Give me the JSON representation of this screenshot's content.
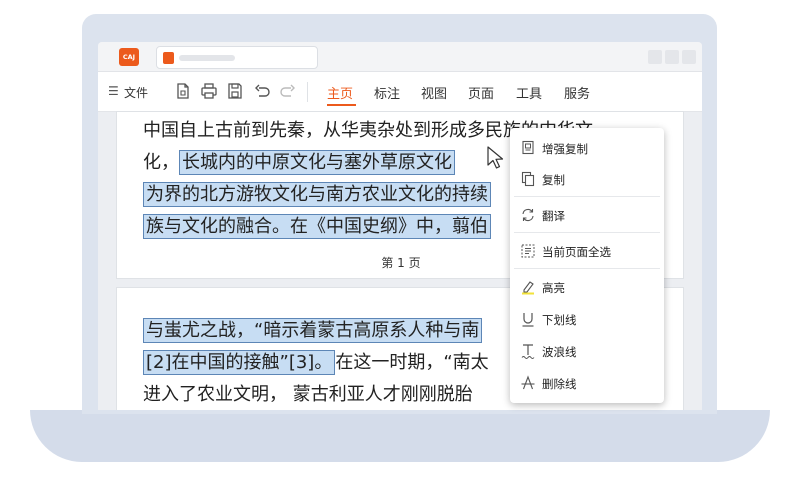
{
  "app": {
    "logo_text": "CAJ"
  },
  "toolbar": {
    "menu_glyph": "☰",
    "file_label": "文件",
    "tabs": [
      {
        "label": "主页",
        "active": true
      },
      {
        "label": "标注",
        "active": false
      },
      {
        "label": "视图",
        "active": false
      },
      {
        "label": "页面",
        "active": false
      },
      {
        "label": "工具",
        "active": false
      },
      {
        "label": "服务",
        "active": false
      }
    ]
  },
  "document": {
    "page1": {
      "line1": "中国自上古前到先秦，从华夷杂处到形成多民族的中华文",
      "line2_prefix": "化，",
      "line2_hl": "长城内的中原文化与塞外草原文化",
      "line3_hl": "为界的北方游牧文化与南方农业文化的持续",
      "line4_hl": "族与文化的融合。在《中国史纲》中，翦伯",
      "page_number": "第 1 页"
    },
    "page2": {
      "line1_hl": "与蚩尤之战，“暗示着蒙古高原系人种与南",
      "line2_hl": "[2]在中国的接触”[3]。",
      "line2_rest": "在这一时期，“南太",
      "line3": "进入了农业文明，  蒙古利亚人才刚刚脱胎"
    }
  },
  "context_menu": {
    "items": [
      {
        "label": "增强复制",
        "icon": "enhanced-copy-icon"
      },
      {
        "label": "复制",
        "icon": "copy-icon"
      },
      {
        "label": "翻译",
        "icon": "translate-icon"
      },
      {
        "label": "当前页面全选",
        "icon": "select-all-icon"
      },
      {
        "label": "高亮",
        "icon": "highlight-icon"
      },
      {
        "label": "下划线",
        "icon": "underline-icon"
      },
      {
        "label": "波浪线",
        "icon": "wavy-line-icon"
      },
      {
        "label": "删除线",
        "icon": "strikethrough-icon"
      }
    ]
  },
  "colors": {
    "accent": "#ec5a1c",
    "highlight": "#c7ddf3",
    "highlight_border": "#5d86b6",
    "highlight_marker": "#f2e23a"
  }
}
